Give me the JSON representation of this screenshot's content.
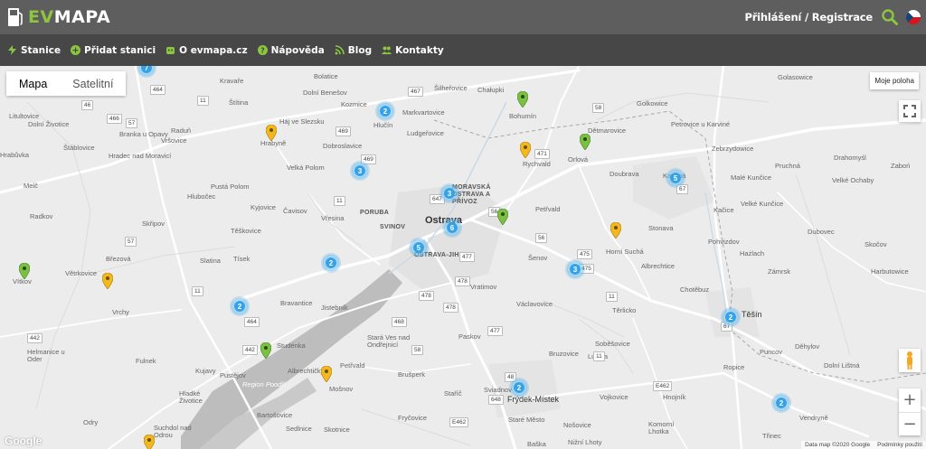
{
  "header": {
    "logo_ev": "EV",
    "logo_mapa": "MAPA",
    "login_label": "Přihlášení / Registrace",
    "search_icon": "search-icon",
    "flag_icon": "czech-flag-icon",
    "accent_color": "#8cc63f"
  },
  "nav": {
    "items": [
      {
        "label": "Stanice",
        "icon": "bolt-icon"
      },
      {
        "label": "Přidat stanici",
        "icon": "plus-circle-icon"
      },
      {
        "label": "O evmapa.cz",
        "icon": "robot-icon"
      },
      {
        "label": "Nápověda",
        "icon": "question-icon"
      },
      {
        "label": "Blog",
        "icon": "rss-icon"
      },
      {
        "label": "Kontakty",
        "icon": "people-icon"
      }
    ]
  },
  "map": {
    "type_buttons": [
      "Mapa",
      "Satelitní"
    ],
    "my_location": "Moje poloha",
    "zoom_in": "+",
    "zoom_out": "−",
    "google": "Google",
    "attribution": "Data map ©2020 Google",
    "terms": "Podmínky použití",
    "city": "Ostrava",
    "labels": {
      "kravare": "Kravaře",
      "dolni_benesov": "Dolní Benešov",
      "bolatice": "Bolatice",
      "silherovice": "Šilheřovice",
      "chalupki": "Chałupki",
      "golasowice": "Golasowice",
      "stitina": "Štítina",
      "kozmice": "Kozmice",
      "markvartovice": "Markvartovice",
      "bohumin": "Bohumín",
      "golkowice": "Golkowice",
      "petrovice": "Petrovice u Karviné",
      "litultovice": "Litultovice",
      "dolni_zivotice": "Dolní Životice",
      "haj": "Háj ve Slezsku",
      "hlucin": "Hlučín",
      "ludgerovice": "Ludgeřovice",
      "detmarovice": "Dětmarovice",
      "branka": "Branka u Opavy",
      "radun": "Raduň",
      "vrsovice": "Vršovice",
      "hrabyne": "Hrabyně",
      "dobroslavice": "Dobroslavice",
      "rychvald": "Rychvald",
      "orlova": "Orlová",
      "hradec": "Hradec nad Moravicí",
      "stablovice": "Štáblovice",
      "velka_polom": "Velká Polom",
      "doubrava": "Doubrava",
      "zebrzydowice": "Zebrzydowice",
      "pruchna": "Pruchná",
      "moravska_ostrava": "MORAVSKÁ OSTRAVA A PŘÍVOZ",
      "karvina": "Karviná",
      "malé_kuncice": "Malé Kunčice",
      "dolni_kuncice": "Velké Kunčice",
      "melc": "Melč",
      "hlubocec": "Hlubočec",
      "pusta_polom": "Pustá Polom",
      "kyjovice": "Kyjovice",
      "cavisov": "Čavisov",
      "porubka": "PORUBA",
      "vresina": "Vřesina",
      "svinov": "SVINOV",
      "petrvald": "Petřvald",
      "stonava": "Stonava",
      "kacice": "Kačice",
      "radkov": "Radkov",
      "skripov": "Skřipov",
      "teskovice": "Těškovice",
      "horni_sucha": "Horní Suchá",
      "pohvizdov": "Pohvizdov",
      "dubovec": "Dubovec",
      "skocov": "Skočov",
      "slatina": "Slatina",
      "tisek": "Tísek",
      "ostrava_jih": "OSTRAVA-JIH",
      "senov": "Šenov",
      "zamrsk": "Zámrsk",
      "hazlach": "Hażlach",
      "vitkov": "Vítkov",
      "vetrkovice": "Větrkovice",
      "brezova": "Březová",
      "vratimov": "Vratimov",
      "albrechtice": "Albrechtice",
      "harbutowice": "Harbutowice",
      "vrchy": "Vrchy",
      "bravantice": "Bravantice",
      "jistebnik": "Jistebník",
      "vaclavovice": "Václavovice",
      "terlicko": "Těrlicko",
      "chotebuz": "Chotěbuz",
      "tesin": "Těšín",
      "studenka": "Studénka",
      "stara_ves": "Stará Ves nad Ondřejnicí",
      "paskov": "Paskov",
      "sobesovice": "Soběšovice",
      "puncov": "Puncov",
      "dehylov": "Děhylov",
      "helmanice": "Helmanice u Oder",
      "fulnek": "Fulnek",
      "kujavy": "Kujavy",
      "pustejov": "Pustějov",
      "albrechticky": "Albrechtičky",
      "petrvald2": "Petřvald",
      "brusperk": "Brušperk",
      "bruzovice": "Bruzovice",
      "lucina": "Lučina",
      "ropice": "Ropice",
      "dolni_kunice2": "Dolní Lištná",
      "hladke": "Hladké Životice",
      "region_poodri": "Region Poodří",
      "mosnov": "Mošnov",
      "stachi": "Staříč",
      "sviadnov": "Sviadnov",
      "frydek": "Frýdek-Místek",
      "vojkovice": "Vojkovice",
      "hnojnik": "Hnojník",
      "vendryne": "Vendryně",
      "bartosovice": "Bartošovice",
      "sedlnice": "Sedlnice",
      "frycovice": "Fryčovice",
      "staré_mesto": "Staré Město",
      "nosovice": "Nošovice",
      "komorni": "Komorní Lhotka",
      "trinec": "Třinec",
      "suchdol": "Suchdol nad Odrou",
      "skotnice": "Skotnice",
      "odry": "Odry",
      "baska": "Baška",
      "nizni_lhoty": "Nižní Lhoty",
      "zabon": "Zaboń",
      "drahomysl": "Drahomyśl",
      "velke_ochaby": "Velké Ochaby",
      "dolni_zivotice2": "Hrabůvka"
    },
    "road_numbers": [
      "464",
      "11",
      "46",
      "469",
      "467",
      "57",
      "466",
      "469",
      "471",
      "58",
      "67",
      "11",
      "647",
      "56",
      "56",
      "475",
      "475",
      "478",
      "478",
      "477",
      "442",
      "11",
      "468",
      "58",
      "67",
      "464",
      "48",
      "648",
      "E462",
      "E462",
      "477",
      "11",
      "442",
      "57",
      "11",
      "478"
    ],
    "clusters": [
      "7",
      "2",
      "3",
      "3",
      "6",
      "5",
      "2",
      "3",
      "5",
      "2",
      "2",
      "2",
      "2"
    ],
    "pins": [
      {
        "color": "#7ac143"
      },
      {
        "color": "#f2b81d"
      },
      {
        "color": "#f2b81d"
      },
      {
        "color": "#7ac143"
      },
      {
        "color": "#7ac143"
      },
      {
        "color": "#f2b81d"
      },
      {
        "color": "#7ac143"
      },
      {
        "color": "#f2b81d"
      },
      {
        "color": "#7ac143"
      },
      {
        "color": "#f2b81d"
      },
      {
        "color": "#f2b81d"
      }
    ]
  }
}
